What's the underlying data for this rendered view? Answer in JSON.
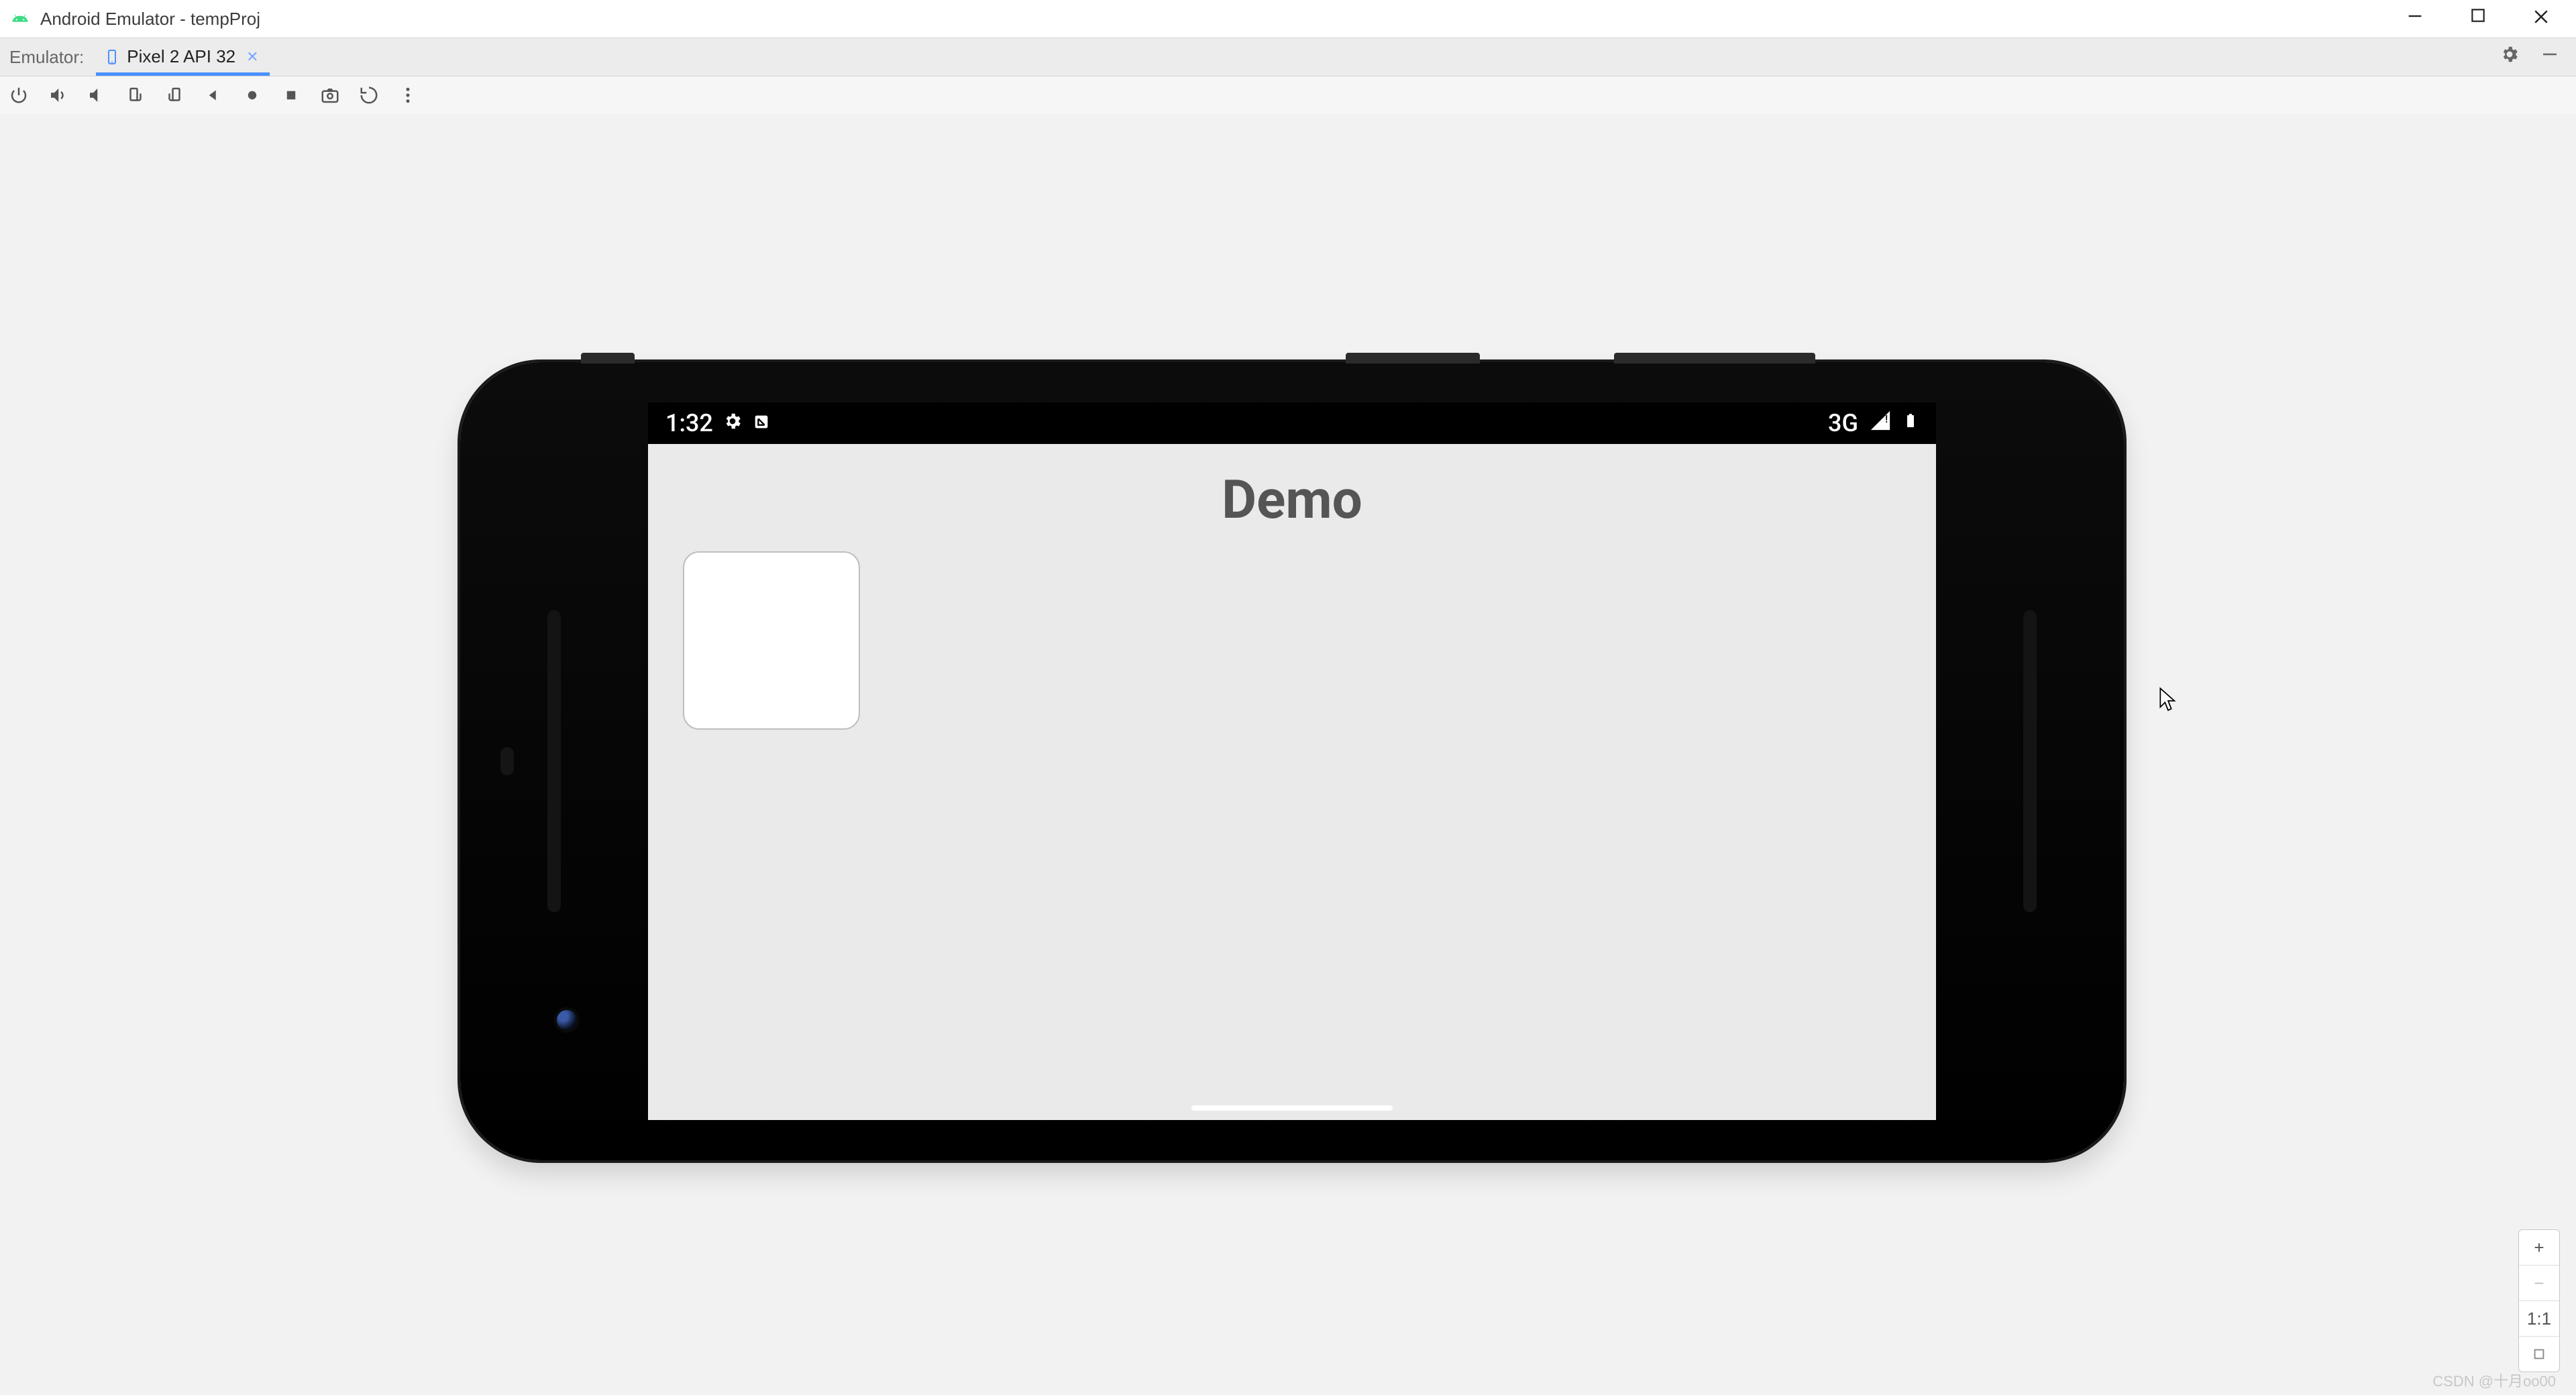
{
  "window": {
    "title": "Android Emulator - tempProj"
  },
  "tabstrip": {
    "fixed_label": "Emulator:",
    "tab_label": "Pixel 2 API 32"
  },
  "device": {
    "statusbar": {
      "time": "1:32",
      "network": "3G"
    },
    "app": {
      "title": "Demo"
    }
  },
  "zoom": {
    "ratio_label": "1:1"
  },
  "watermark": "CSDN @十月oo00"
}
